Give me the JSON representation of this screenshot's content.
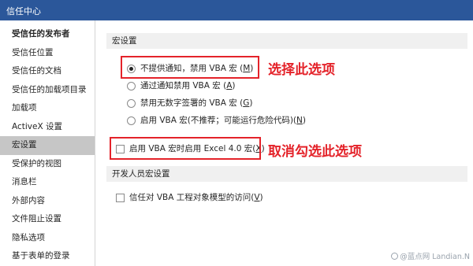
{
  "window": {
    "title": "信任中心"
  },
  "sidebar": {
    "items": [
      {
        "label": "受信任的发布者"
      },
      {
        "label": "受信任位置"
      },
      {
        "label": "受信任的文档"
      },
      {
        "label": "受信任的加载项目录"
      },
      {
        "label": "加载项"
      },
      {
        "label": "ActiveX 设置"
      },
      {
        "label": "宏设置"
      },
      {
        "label": "受保护的视图"
      },
      {
        "label": "消息栏"
      },
      {
        "label": "外部内容"
      },
      {
        "label": "文件阻止设置"
      },
      {
        "label": "隐私选项"
      },
      {
        "label": "基于表单的登录"
      }
    ],
    "active_item": "宏设置"
  },
  "macro_settings": {
    "header": "宏设置",
    "options": [
      {
        "text": "不提供通知，禁用 VBA 宏 (",
        "key": "M",
        "end": ")",
        "checked": true
      },
      {
        "text": "通过通知禁用 VBA 宏 (",
        "key": "A",
        "end": ")",
        "checked": false
      },
      {
        "text": "禁用无数字签署的 VBA 宏 (",
        "key": "G",
        "end": ")",
        "checked": false
      },
      {
        "text": "启用 VBA 宏(不推荐；可能运行危险代码)(",
        "key": "N",
        "end": ")",
        "checked": false
      }
    ],
    "excel4_option": {
      "text": "启用 VBA 宏时启用 Excel 4.0 宏(",
      "key": "X",
      "end": ")",
      "checked": false
    }
  },
  "developer_settings": {
    "header": "开发人员宏设置",
    "trust_option": {
      "text": "信任对 VBA 工程对象模型的访问(",
      "key": "V",
      "end": ")",
      "checked": false
    }
  },
  "annotations": {
    "first": "选择此选项",
    "second": "取消勾选此选项",
    "color": "#e4232a"
  },
  "watermark": {
    "text": "@蓝点网 Landian.N"
  }
}
